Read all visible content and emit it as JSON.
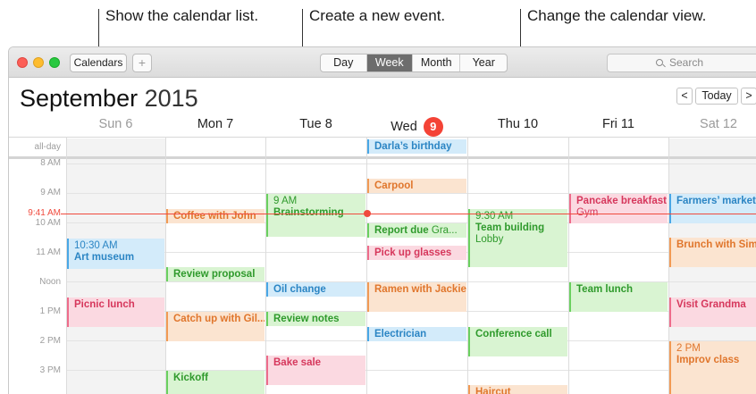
{
  "callouts": {
    "calendar_list": "Show the calendar list.",
    "new_event": "Create a new event.",
    "change_view": "Change the calendar view."
  },
  "toolbar": {
    "calendars_label": "Calendars",
    "add_label": "+",
    "views": [
      "Day",
      "Week",
      "Month",
      "Year"
    ],
    "active_view": "Week",
    "search_placeholder": "Search",
    "search_icon": "magnifier-icon"
  },
  "header": {
    "month": "September",
    "year": "2015",
    "prev_label": "<",
    "today_label": "Today",
    "next_label": ">"
  },
  "days": [
    {
      "label": "Sun 6",
      "weekend": true
    },
    {
      "label": "Mon 7",
      "weekend": false
    },
    {
      "label": "Tue 8",
      "weekend": false
    },
    {
      "label": "Wed",
      "badge": "9",
      "weekend": false,
      "today": true
    },
    {
      "label": "Thu 10",
      "weekend": false
    },
    {
      "label": "Fri 11",
      "weekend": false
    },
    {
      "label": "Sat 12",
      "weekend": true
    }
  ],
  "time_labels": {
    "allday": "all-day",
    "h8": "8 AM",
    "h9": "9 AM",
    "h10": "10 AM",
    "h11": "11 AM",
    "noon": "Noon",
    "h13": "1 PM",
    "h14": "2 PM",
    "h15": "3 PM",
    "now": "9:41 AM"
  },
  "events": {
    "darla": "Darla’s birthday",
    "carpool": "Carpool",
    "brainstorm_time": "9 AM",
    "brainstorm": "Brainstorming",
    "pancake": "Pancake breakfast",
    "pancake_sub": "Gym",
    "farmers": "Farmers’ market",
    "coffee": "Coffee with John",
    "teambuilding_time": "9:30 AM",
    "teambuilding": "Team building",
    "teambuilding_sub": "Lobby",
    "report": "Report due",
    "report_sub": "Gra...",
    "artmuseum_time": "10:30 AM",
    "artmuseum": "Art museum",
    "glasses": "Pick up glasses",
    "brunch": "Brunch with Sim...",
    "review": "Review proposal",
    "oil": "Oil change",
    "ramen": "Ramen with Jackie",
    "teamlunch": "Team lunch",
    "picnic": "Picnic lunch",
    "visit": "Visit Grandma",
    "catchup": "Catch up with Gil...",
    "reviewnotes": "Review notes",
    "electrician": "Electrician",
    "conference": "Conference call",
    "improv_time": "2 PM",
    "improv": "Improv class",
    "bakesale": "Bake sale",
    "kickoff": "Kickoff",
    "haircut": "Haircut"
  },
  "colors": {
    "today_badge": "#f44336",
    "now_line": "#f04a3d",
    "orange": "#e0762c",
    "green": "#2f9a2c",
    "blue": "#2b85c4",
    "pink": "#d6375c"
  }
}
